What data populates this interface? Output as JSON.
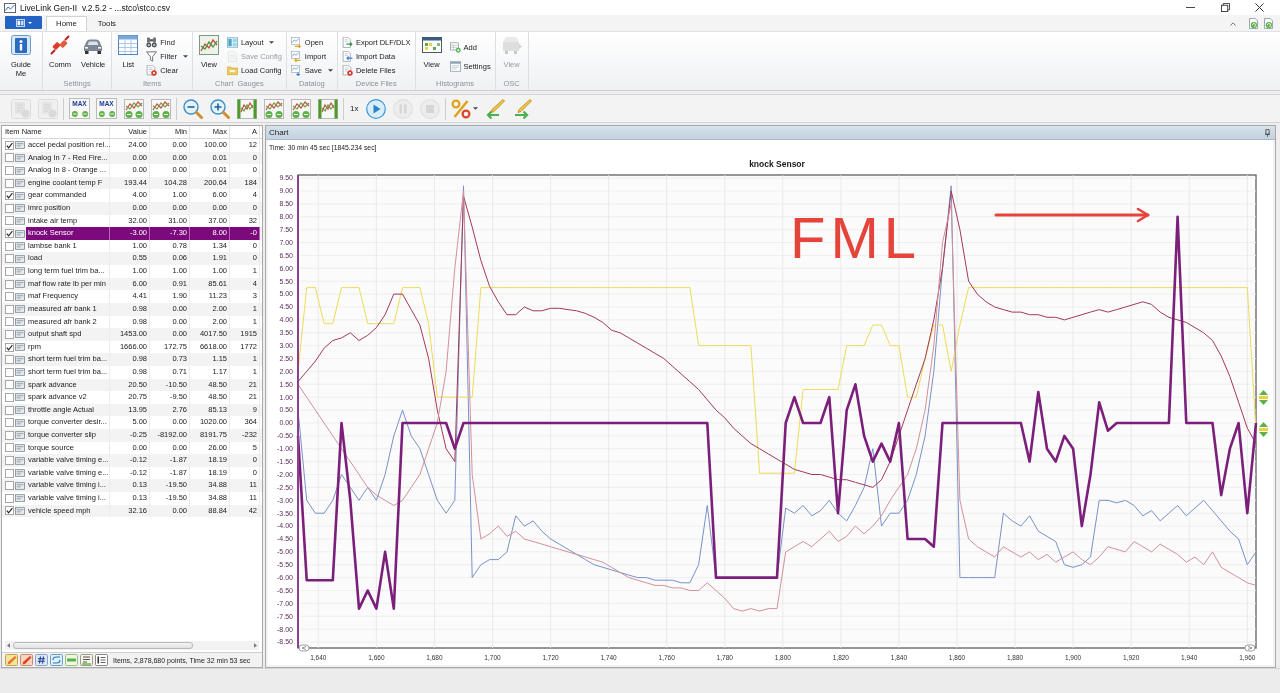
{
  "window": {
    "title": "LiveLink Gen-II  v.2.5.2 - ...stco\\stco.csv"
  },
  "ribbon": {
    "tabs": [
      {
        "label": "Home",
        "selected": true
      },
      {
        "label": "Tools",
        "selected": false
      }
    ],
    "groups": [
      {
        "items": [
          {
            "kind": "large",
            "label": "Guide Me",
            "disabled": false,
            "dropdown": false
          }
        ]
      },
      {
        "label": "Settings",
        "items": [
          {
            "kind": "large",
            "label": "Comm",
            "disabled": false,
            "dropdown": false
          },
          {
            "kind": "large",
            "label": "Vehicle",
            "disabled": false,
            "dropdown": false
          }
        ]
      },
      {
        "label": "Items",
        "items": [
          {
            "kind": "large",
            "label": "List",
            "disabled": false,
            "dropdown": false
          },
          {
            "kind": "small",
            "label": "Find",
            "disabled": false,
            "dropdown": false
          },
          {
            "kind": "small",
            "label": "Filter",
            "disabled": false,
            "dropdown": true
          },
          {
            "kind": "small",
            "label": "Clear",
            "disabled": false,
            "dropdown": false
          }
        ]
      },
      {
        "label": "Chart  Gauges",
        "items": [
          {
            "kind": "large",
            "label": "View",
            "disabled": false,
            "dropdown": false
          },
          {
            "kind": "small",
            "label": "Layout",
            "disabled": false,
            "dropdown": true
          },
          {
            "kind": "small",
            "label": "Save Config",
            "disabled": true,
            "dropdown": false
          },
          {
            "kind": "small",
            "label": "Load Config",
            "disabled": false,
            "dropdown": false
          }
        ]
      },
      {
        "label": "Datalog",
        "items": [
          {
            "kind": "small",
            "label": "Open",
            "disabled": false,
            "dropdown": false
          },
          {
            "kind": "small",
            "label": "Import",
            "disabled": false,
            "dropdown": false
          },
          {
            "kind": "small",
            "label": "Save",
            "disabled": false,
            "dropdown": true
          }
        ]
      },
      {
        "label": "Device Files",
        "items": [
          {
            "kind": "small",
            "label": "Export DLF/DLX",
            "disabled": false,
            "dropdown": false
          },
          {
            "kind": "small",
            "label": "Import Data",
            "disabled": false,
            "dropdown": false
          },
          {
            "kind": "small",
            "label": "Delete Files",
            "disabled": false,
            "dropdown": false
          }
        ]
      },
      {
        "label": "Histograms",
        "items": [
          {
            "kind": "large",
            "label": "View",
            "disabled": false,
            "dropdown": false
          },
          {
            "kind": "small",
            "label": "Add",
            "disabled": false,
            "dropdown": false
          },
          {
            "kind": "small",
            "label": "Settings",
            "disabled": false,
            "dropdown": false
          }
        ]
      },
      {
        "label": "OSC",
        "items": [
          {
            "kind": "large",
            "label": "View",
            "disabled": true,
            "dropdown": false
          }
        ]
      }
    ]
  },
  "toolbar": {
    "groups": [
      {
        "buttons": [
          {
            "kind": "icon",
            "disabled": true,
            "dropdown": false
          },
          {
            "kind": "icon",
            "disabled": true,
            "dropdown": false
          }
        ]
      },
      {
        "buttons": [
          {
            "kind": "max",
            "label": "MAX",
            "disabled": false,
            "dropdown": false
          },
          {
            "kind": "max",
            "label": "MAX",
            "disabled": false,
            "dropdown": false
          },
          {
            "kind": "icon",
            "disabled": false,
            "dropdown": false
          },
          {
            "kind": "icon",
            "disabled": false,
            "dropdown": false
          }
        ]
      },
      {
        "buttons": [
          {
            "kind": "icon",
            "disabled": false,
            "dropdown": false
          },
          {
            "kind": "icon",
            "disabled": false,
            "dropdown": false
          },
          {
            "kind": "icon",
            "disabled": false,
            "dropdown": false
          },
          {
            "kind": "icon",
            "disabled": false,
            "dropdown": false
          },
          {
            "kind": "icon",
            "disabled": false,
            "dropdown": false
          },
          {
            "kind": "icon",
            "disabled": false,
            "dropdown": false
          }
        ]
      },
      {
        "buttons": [
          {
            "kind": "text",
            "label": "1x",
            "disabled": false,
            "dropdown": false
          },
          {
            "kind": "round",
            "disabled": false,
            "dropdown": false
          },
          {
            "kind": "round",
            "disabled": true,
            "dropdown": false
          },
          {
            "kind": "round",
            "disabled": true,
            "dropdown": false
          }
        ]
      },
      {
        "buttons": [
          {
            "kind": "icon",
            "disabled": false,
            "dropdown": true
          },
          {
            "kind": "icon",
            "disabled": false,
            "dropdown": false
          },
          {
            "kind": "icon",
            "disabled": false,
            "dropdown": false
          }
        ]
      }
    ]
  },
  "items_panel": {
    "columns": [
      "Item Name",
      "Value",
      "Min",
      "Max",
      "A"
    ],
    "rows": [
      {
        "checked": true,
        "selected": false,
        "cells": [
          "accel pedal position rel...",
          "24.00",
          "0.00",
          "100.00",
          "12"
        ]
      },
      {
        "checked": false,
        "selected": false,
        "cells": [
          "Analog In 7 - Red Fire...",
          "0.00",
          "0.00",
          "0.01",
          "0"
        ]
      },
      {
        "checked": false,
        "selected": false,
        "cells": [
          "Analog In 8 - Orange ...",
          "0.00",
          "0.00",
          "0.01",
          "0"
        ]
      },
      {
        "checked": false,
        "selected": false,
        "cells": [
          "engine coolant temp F",
          "193.44",
          "104.28",
          "200.64",
          "184"
        ]
      },
      {
        "checked": true,
        "selected": false,
        "cells": [
          "gear commanded",
          "4.00",
          "1.00",
          "6.00",
          "4"
        ]
      },
      {
        "checked": false,
        "selected": false,
        "cells": [
          "imrc position",
          "0.00",
          "0.00",
          "0.00",
          "0"
        ]
      },
      {
        "checked": false,
        "selected": false,
        "cells": [
          "intake air temp",
          "32.00",
          "31.00",
          "37.00",
          "32"
        ]
      },
      {
        "checked": true,
        "selected": true,
        "cells": [
          "knock Sensor",
          "-3.00",
          "-7.30",
          "8.00",
          "-0"
        ]
      },
      {
        "checked": false,
        "selected": false,
        "cells": [
          "lambse bank 1",
          "1.00",
          "0.78",
          "1.34",
          "0"
        ]
      },
      {
        "checked": false,
        "selected": false,
        "cells": [
          "load",
          "0.55",
          "0.06",
          "1.91",
          "0"
        ]
      },
      {
        "checked": false,
        "selected": false,
        "cells": [
          "long term fuel trim ba...",
          "1.00",
          "1.00",
          "1.00",
          "1"
        ]
      },
      {
        "checked": false,
        "selected": false,
        "cells": [
          "maf flow rate lb per min",
          "6.00",
          "0.91",
          "85.61",
          "4"
        ]
      },
      {
        "checked": false,
        "selected": false,
        "cells": [
          "maf Frequency",
          "4.41",
          "1.90",
          "11.23",
          "3"
        ]
      },
      {
        "checked": false,
        "selected": false,
        "cells": [
          "measured afr bank 1",
          "0.98",
          "0.00",
          "2.00",
          "1"
        ]
      },
      {
        "checked": false,
        "selected": false,
        "cells": [
          "measured afr bank 2",
          "0.98",
          "0.00",
          "2.00",
          "1"
        ]
      },
      {
        "checked": false,
        "selected": false,
        "cells": [
          "output shaft spd",
          "1453.00",
          "0.00",
          "4017.50",
          "1915"
        ]
      },
      {
        "checked": true,
        "selected": false,
        "cells": [
          "rpm",
          "1666.00",
          "172.75",
          "6618.00",
          "1772"
        ]
      },
      {
        "checked": false,
        "selected": false,
        "cells": [
          "short term fuel trim ba...",
          "0.98",
          "0.73",
          "1.15",
          "1"
        ]
      },
      {
        "checked": false,
        "selected": false,
        "cells": [
          "short term fuel trim ba...",
          "0.98",
          "0.71",
          "1.17",
          "1"
        ]
      },
      {
        "checked": false,
        "selected": false,
        "cells": [
          "spark advance",
          "20.50",
          "-10.50",
          "48.50",
          "21"
        ]
      },
      {
        "checked": false,
        "selected": false,
        "cells": [
          "spark advance v2",
          "20.75",
          "-9.50",
          "48.50",
          "21"
        ]
      },
      {
        "checked": false,
        "selected": false,
        "cells": [
          "throttle angle Actual",
          "13.95",
          "2.76",
          "85.13",
          "9"
        ]
      },
      {
        "checked": false,
        "selected": false,
        "cells": [
          "torque converter desir...",
          "5.00",
          "0.00",
          "1020.00",
          "364"
        ]
      },
      {
        "checked": false,
        "selected": false,
        "cells": [
          "torque converter slip",
          "-0.25",
          "-8192.00",
          "8191.75",
          "-232"
        ]
      },
      {
        "checked": false,
        "selected": false,
        "cells": [
          "torque source",
          "0.00",
          "0.00",
          "26.00",
          "5"
        ]
      },
      {
        "checked": false,
        "selected": false,
        "cells": [
          "variable valve timing e...",
          "-0.12",
          "-1.87",
          "18.19",
          "0"
        ]
      },
      {
        "checked": false,
        "selected": false,
        "cells": [
          "variable valve timing e...",
          "-0.12",
          "-1.87",
          "18.19",
          "0"
        ]
      },
      {
        "checked": false,
        "selected": false,
        "cells": [
          "variable valve timing i...",
          "0.13",
          "-19.50",
          "34.88",
          "11"
        ]
      },
      {
        "checked": false,
        "selected": false,
        "cells": [
          "variable valve timing i...",
          "0.13",
          "-19.50",
          "34.88",
          "11"
        ]
      },
      {
        "checked": true,
        "selected": false,
        "cells": [
          "vehicle speed mph",
          "32.16",
          "0.00",
          "88.84",
          "42"
        ]
      }
    ],
    "status_text": "Items, 2,878,680 points, Time 32 min 53 sec"
  },
  "chart_panel": {
    "title": "Chart",
    "time_readout": "Time: 30 min 45 sec [1845.234 sec]",
    "chart_data": {
      "type": "line",
      "title": "knock Sensor",
      "x": [
        1633,
        1636,
        1639,
        1642,
        1645,
        1648,
        1651,
        1654,
        1657,
        1660,
        1663,
        1666,
        1669,
        1672,
        1675,
        1678,
        1681,
        1684,
        1687,
        1690,
        1693,
        1696,
        1699,
        1702,
        1705,
        1708,
        1711,
        1714,
        1717,
        1720,
        1723,
        1726,
        1729,
        1732,
        1735,
        1738,
        1741,
        1744,
        1747,
        1750,
        1753,
        1756,
        1759,
        1762,
        1765,
        1768,
        1771,
        1774,
        1777,
        1780,
        1783,
        1786,
        1789,
        1792,
        1795,
        1798,
        1801,
        1804,
        1807,
        1810,
        1813,
        1816,
        1819,
        1822,
        1825,
        1828,
        1831,
        1834,
        1837,
        1840,
        1843,
        1846,
        1849,
        1852,
        1855,
        1858,
        1861,
        1864,
        1867,
        1870,
        1873,
        1876,
        1879,
        1882,
        1885,
        1888,
        1891,
        1894,
        1897,
        1900,
        1903,
        1906,
        1909,
        1912,
        1915,
        1918,
        1921,
        1924,
        1927,
        1930,
        1933,
        1936,
        1939,
        1942,
        1945,
        1948,
        1951,
        1954,
        1957,
        1960,
        1963
      ],
      "series": [
        {
          "color": "#7892c8",
          "values": [
            0.5,
            -3.0,
            -3.5,
            -3.5,
            -3.0,
            -2.0,
            -2.5,
            -3.0,
            -2.5,
            -3.0,
            -2.0,
            -0.5,
            0.5,
            -0.5,
            -1.0,
            -2.0,
            -3.0,
            -3.5,
            -3.0,
            9.2,
            -6.0,
            -5.5,
            -5.3,
            -5.3,
            -5.0,
            -3.6,
            -4.0,
            -3.8,
            -4.2,
            -4.5,
            -4.7,
            -4.9,
            -5.1,
            -5.3,
            -5.5,
            -5.6,
            -5.7,
            -5.8,
            -5.9,
            -6.0,
            -6.0,
            -6.1,
            -6.1,
            -6.1,
            -6.2,
            -6.2,
            -5.5,
            -3.2,
            -6.0,
            -6.0,
            -6.0,
            -6.0,
            -6.0,
            -6.0,
            -6.0,
            -6.0,
            -3.3,
            -3.5,
            -3.2,
            -3.6,
            -3.4,
            -3.0,
            -3.5,
            -3.8,
            -3.2,
            -2.5,
            -1.0,
            -4.0,
            -3.5,
            -3.5,
            -3.0,
            -2.0,
            -0.5,
            2.0,
            6.0,
            9.2,
            -6.0,
            -6.0,
            -6.0,
            -6.0,
            -6.0,
            -3.5,
            -3.8,
            -4.0,
            -3.6,
            -4.2,
            -4.4,
            -4.6,
            -5.5,
            -5.6,
            -5.5,
            -5.2,
            -3.0,
            -3.0,
            -3.1,
            -3.0,
            -3.2,
            -3.6,
            -3.4,
            -3.8,
            -3.5,
            -3.2,
            -3.6,
            -3.3,
            -3.0,
            -3.4,
            -3.8,
            -4.2,
            -4.5,
            -5.5,
            -5.0
          ]
        },
        {
          "color": "#eedb5a",
          "values": [
            2.0,
            5.25,
            5.25,
            3.85,
            3.85,
            5.25,
            5.25,
            5.25,
            3.85,
            3.85,
            3.85,
            3.85,
            5.25,
            5.25,
            5.25,
            3.85,
            1.0,
            1.0,
            1.0,
            1.0,
            1.0,
            5.25,
            5.25,
            5.25,
            5.25,
            5.25,
            5.25,
            5.25,
            5.25,
            5.25,
            5.25,
            5.25,
            5.25,
            5.25,
            5.25,
            5.25,
            5.25,
            5.25,
            5.25,
            5.25,
            5.25,
            5.25,
            5.25,
            5.25,
            5.25,
            5.25,
            3.0,
            3.0,
            3.0,
            3.0,
            3.0,
            3.0,
            3.0,
            -1.95,
            -1.95,
            -1.95,
            -1.95,
            -1.95,
            1.3,
            1.3,
            1.3,
            1.3,
            1.3,
            3.0,
            3.0,
            3.0,
            3.8,
            3.8,
            3.0,
            3.0,
            1.0,
            1.0,
            2.5,
            3.8,
            3.8,
            2.0,
            3.8,
            5.25,
            5.25,
            5.25,
            5.25,
            5.25,
            5.25,
            5.25,
            5.25,
            5.25,
            5.25,
            5.25,
            5.25,
            5.25,
            5.25,
            5.25,
            5.25,
            5.25,
            5.25,
            5.25,
            5.25,
            5.25,
            5.25,
            5.25,
            5.25,
            5.25,
            5.25,
            5.25,
            5.25,
            5.25,
            5.25,
            5.25,
            5.25,
            5.25,
            -0.3
          ]
        },
        {
          "color": "#7b1f7b",
          "values": [
            -0.5,
            -6.1,
            -6.1,
            -6.1,
            -6.1,
            0,
            -3.0,
            -7.2,
            -6.5,
            -7.2,
            -5.0,
            -7.2,
            0,
            0,
            0,
            0,
            0,
            0,
            -1.0,
            0,
            0,
            0,
            0,
            0,
            0,
            0,
            0,
            0,
            0,
            0,
            0,
            0,
            0,
            0,
            0,
            0,
            0,
            0,
            0,
            0,
            0,
            0,
            0,
            0,
            0,
            0,
            0,
            0,
            -6.0,
            -6.0,
            -6.0,
            -6.0,
            -6.0,
            -6.0,
            -6.0,
            -6.0,
            0,
            1.0,
            0,
            0,
            0,
            1.0,
            -3.5,
            0.5,
            1.5,
            -0.5,
            -1.5,
            -0.8,
            -1.5,
            0,
            -4.5,
            -4.5,
            -4.5,
            -4.8,
            0,
            0,
            0,
            0,
            0,
            0,
            0,
            0,
            0,
            0,
            -1.5,
            1.2,
            -1.0,
            -1.5,
            -0.5,
            -1.0,
            -4.0,
            -2.0,
            0.8,
            -0.3,
            0,
            0,
            0,
            0,
            0,
            0,
            0,
            8.0,
            0,
            0,
            0,
            0,
            -2.8,
            -1.0,
            0,
            -3.5,
            0
          ]
        },
        {
          "color": "#a33a56",
          "values": [
            1.6,
            2.0,
            2.4,
            2.9,
            3.2,
            3.3,
            3.5,
            3.2,
            3.4,
            3.7,
            4.2,
            5.0,
            5.0,
            4.4,
            3.8,
            2.5,
            0.5,
            -1.0,
            -1.5,
            8.8,
            7.6,
            6.3,
            5.3,
            4.7,
            4.2,
            4.2,
            4.5,
            4.35,
            4.35,
            4.45,
            4.45,
            4.4,
            4.35,
            4.25,
            4.1,
            3.9,
            3.6,
            3.5,
            3.3,
            3.1,
            2.9,
            2.7,
            2.5,
            2.2,
            1.9,
            1.6,
            1.3,
            0.9,
            0.5,
            0.2,
            -0.2,
            -0.5,
            -0.8,
            -1.0,
            -1.2,
            -1.4,
            -1.6,
            -1.8,
            -1.9,
            -2.0,
            -2.0,
            -2.1,
            -2.2,
            -2.2,
            -2.3,
            -2.4,
            -2.5,
            -2.2,
            -1.5,
            -0.5,
            0.5,
            1.5,
            2.5,
            4.0,
            6.0,
            9.0,
            7.5,
            5.5,
            5.0,
            4.7,
            4.5,
            4.4,
            4.3,
            4.3,
            4.2,
            4.2,
            4.1,
            4.1,
            4.0,
            4.1,
            4.2,
            4.3,
            4.4,
            4.3,
            4.4,
            4.5,
            4.6,
            4.7,
            4.6,
            4.3,
            4.1,
            4.0,
            3.9,
            3.7,
            3.5,
            3.2,
            2.6,
            1.8,
            0.8,
            -0.2,
            -0.8
          ]
        },
        {
          "color": "#d4909a",
          "values": [
            1.5,
            1.0,
            0.5,
            0.0,
            -0.5,
            -1.0,
            -1.5,
            -2.0,
            -2.5,
            -2.8,
            -3.0,
            -3.2,
            -3.0,
            -2.5,
            -2.0,
            -1.0,
            0.0,
            2.0,
            6.0,
            9.0,
            -2.0,
            -4.5,
            -4.3,
            -4.0,
            -4.4,
            -4.2,
            -4.5,
            -4.6,
            -4.7,
            -4.8,
            -4.9,
            -5.0,
            -5.1,
            -5.2,
            -5.3,
            -5.4,
            -5.6,
            -5.8,
            -6.0,
            -6.1,
            -6.2,
            -6.3,
            -6.3,
            -6.4,
            -6.4,
            -6.5,
            -6.5,
            -6.2,
            -6.5,
            -6.8,
            -7.2,
            -7.3,
            -7.2,
            -7.3,
            -7.2,
            -7.2,
            -5.0,
            -4.8,
            -4.6,
            -4.8,
            -4.5,
            -4.2,
            -4.6,
            -4.4,
            -4.0,
            -4.3,
            -4.0,
            -3.6,
            -3.0,
            -2.5,
            -2.0,
            -1.0,
            0.5,
            3.0,
            7.0,
            8.5,
            -3.0,
            -4.5,
            -4.8,
            -5.0,
            -5.2,
            -4.8,
            -5.0,
            -5.2,
            -5.0,
            -5.3,
            -5.1,
            -5.4,
            -5.2,
            -5.0,
            -5.3,
            -5.5,
            -5.2,
            -4.8,
            -4.9,
            -5.0,
            -4.6,
            -4.8,
            -5.0,
            -4.7,
            -4.9,
            -5.1,
            -5.4,
            -5.2,
            -5.5,
            -5.0,
            -5.6,
            -5.8,
            -6.0,
            -6.2,
            -6.3
          ]
        }
      ],
      "xlim": [
        1633,
        1963
      ],
      "ylim": [
        -8.73,
        9.62
      ],
      "grid": true,
      "xticks": [
        {
          "value": 1640,
          "label": "1,640"
        },
        {
          "value": 1660,
          "label": "1,660"
        },
        {
          "value": 1680,
          "label": "1,680"
        },
        {
          "value": 1700,
          "label": "1,700"
        },
        {
          "value": 1720,
          "label": "1,720"
        },
        {
          "value": 1740,
          "label": "1,740"
        },
        {
          "value": 1760,
          "label": "1,760"
        },
        {
          "value": 1780,
          "label": "1,780"
        },
        {
          "value": 1800,
          "label": "1,800"
        },
        {
          "value": 1820,
          "label": "1,820"
        },
        {
          "value": 1840,
          "label": "1,840"
        },
        {
          "value": 1860,
          "label": "1,860"
        },
        {
          "value": 1880,
          "label": "1,880"
        },
        {
          "value": 1900,
          "label": "1,900"
        },
        {
          "value": 1920,
          "label": "1,920"
        },
        {
          "value": 1940,
          "label": "1,940"
        },
        {
          "value": 1960,
          "label": "1,960"
        }
      ],
      "yticks": [
        {
          "value": 9.5,
          "label": "9.50"
        },
        {
          "value": 9,
          "label": "9.00"
        },
        {
          "value": 8.5,
          "label": "8.50"
        },
        {
          "value": 8,
          "label": "8.00"
        },
        {
          "value": 7.5,
          "label": "7.50"
        },
        {
          "value": 7,
          "label": "7.00"
        },
        {
          "value": 6.5,
          "label": "6.50"
        },
        {
          "value": 6,
          "label": "6.00"
        },
        {
          "value": 5.5,
          "label": "5.50"
        },
        {
          "value": 5,
          "label": "5.00"
        },
        {
          "value": 4.5,
          "label": "4.50"
        },
        {
          "value": 4,
          "label": "4.00"
        },
        {
          "value": 3.5,
          "label": "3.50"
        },
        {
          "value": 3,
          "label": "3.00"
        },
        {
          "value": 2.5,
          "label": "2.50"
        },
        {
          "value": 2,
          "label": "2.00"
        },
        {
          "value": 1.5,
          "label": "1.50"
        },
        {
          "value": 1,
          "label": "1.00"
        },
        {
          "value": 0.5,
          "label": "0.50"
        },
        {
          "value": 0,
          "label": "0.00"
        },
        {
          "value": -0.5,
          "label": "-0.50"
        },
        {
          "value": -1,
          "label": "-1.00"
        },
        {
          "value": -1.5,
          "label": "-1.50"
        },
        {
          "value": -2,
          "label": "-2.00"
        },
        {
          "value": -2.5,
          "label": "-2.50"
        },
        {
          "value": -3,
          "label": "-3.00"
        },
        {
          "value": -3.5,
          "label": "-3.50"
        },
        {
          "value": -4,
          "label": "-4.00"
        },
        {
          "value": -4.5,
          "label": "-4.50"
        },
        {
          "value": -5,
          "label": "-5.00"
        },
        {
          "value": -5.5,
          "label": "-5.50"
        },
        {
          "value": -6,
          "label": "-6.00"
        },
        {
          "value": -6.5,
          "label": "-6.50"
        },
        {
          "value": -7,
          "label": "-7.00"
        },
        {
          "value": -7.5,
          "label": "-7.50"
        },
        {
          "value": -8,
          "label": "-8.00"
        },
        {
          "value": -8.5,
          "label": "-8.50"
        }
      ],
      "annotations": [
        "FML"
      ]
    }
  }
}
